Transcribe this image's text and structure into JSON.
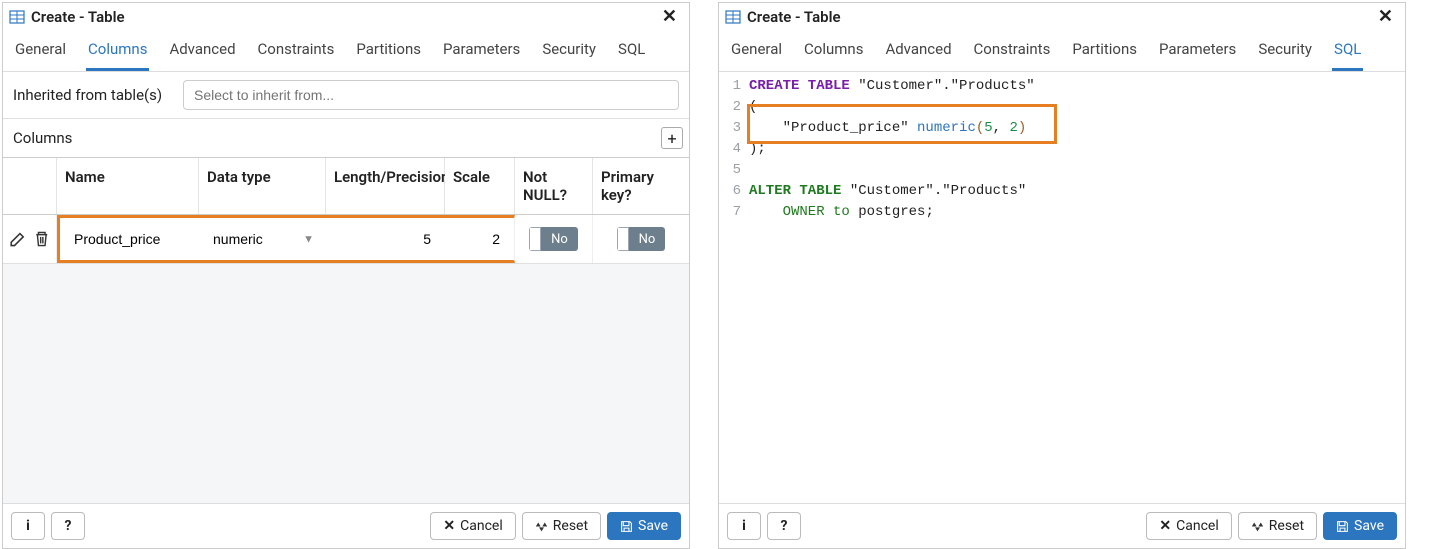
{
  "left": {
    "title": "Create - Table",
    "tabs": [
      "General",
      "Columns",
      "Advanced",
      "Constraints",
      "Partitions",
      "Parameters",
      "Security",
      "SQL"
    ],
    "active_tab": "Columns",
    "inherit_label": "Inherited from table(s)",
    "inherit_placeholder": "Select to inherit from...",
    "columns_section_label": "Columns",
    "add_label": "+",
    "col_headers": {
      "name": "Name",
      "dtype": "Data type",
      "len": "Length/Precision",
      "scale": "Scale",
      "notnull": "Not NULL?",
      "pk": "Primary key?"
    },
    "row": {
      "name": "Product_price",
      "dtype": "numeric",
      "len": "5",
      "scale": "2",
      "notnull": "No",
      "pk": "No"
    },
    "footer": {
      "info": "i",
      "help": "?",
      "cancel": "Cancel",
      "reset": "Reset",
      "save": "Save"
    }
  },
  "right": {
    "title": "Create - Table",
    "tabs": [
      "General",
      "Columns",
      "Advanced",
      "Constraints",
      "Partitions",
      "Parameters",
      "Security",
      "SQL"
    ],
    "active_tab": "SQL",
    "sql_lines": {
      "l1_create": "CREATE TABLE",
      "l1_rest": " \"Customer\".\"Products\"",
      "l2": "(",
      "l3_col": "    \"Product_price\" ",
      "l3_type": "numeric",
      "l3_open": "(",
      "l3_a": "5",
      "l3_comma": ", ",
      "l3_b": "2",
      "l3_close": ")",
      "l4": ");",
      "l5": "",
      "l6_alter": "ALTER TABLE",
      "l6_rest": " \"Customer\".\"Products\"",
      "l7_owner": "    OWNER to",
      "l7_rest": " postgres;"
    },
    "footer": {
      "info": "i",
      "help": "?",
      "cancel": "Cancel",
      "reset": "Reset",
      "save": "Save"
    }
  }
}
